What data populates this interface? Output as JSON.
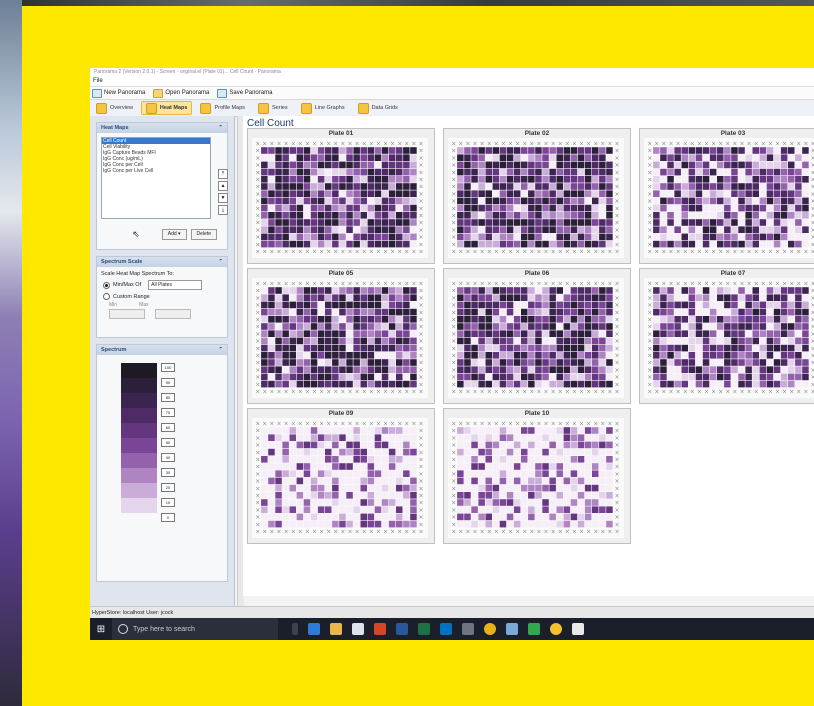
{
  "window": {
    "title": "Panorama 2 (Version 2.0.1) - Screen - original.el (Plate 01)... Cell Count - Panorama",
    "menu": "File"
  },
  "toolbar": {
    "new": "New Panorama",
    "open": "Open Panorama",
    "save": "Save Panorama"
  },
  "tabs": [
    "Overview",
    "Heat Maps",
    "Profile Maps",
    "Series",
    "Line Graphs",
    "Data Grids"
  ],
  "sidebar": {
    "heatmaps_title": "Heat Maps",
    "heatmap_items": [
      "Cell Count",
      "Cell Viability",
      "IgG Capture Beads MFI",
      "IgG Conc (ug/mL)",
      "IgG Conc per Cell",
      "IgG Conc per Live Cell"
    ],
    "add_label": "Add",
    "delete_label": "Delete",
    "spectrum_scale_title": "Spectrum Scale",
    "scale_label": "Scale Heat Map Spectrum To:",
    "minmax_label": "Min/Max Of",
    "minmax_select": "All Plates",
    "custom_label": "Custom Range",
    "min_label": "Min",
    "max_label": "Max",
    "spectrum_title": "Spectrum",
    "spectrum_labels": [
      "100",
      "90",
      "80",
      "70",
      "60",
      "50",
      "40",
      "30",
      "20",
      "10",
      "0"
    ]
  },
  "main": {
    "title": "Cell Count",
    "plates": [
      "Plate 01",
      "Plate 02",
      "Plate 03",
      "Plate 05",
      "Plate 06",
      "Plate 07",
      "Plate 09",
      "Plate 10"
    ]
  },
  "status": "HyperStore: localhost   User: jcock",
  "taskbar": {
    "search_placeholder": "Type here to search"
  },
  "colors": {
    "background": "#ffe800",
    "accent": "#7b3b9a",
    "heat_dark": "#3b1c4f",
    "heat_light": "#f2e8f3"
  }
}
